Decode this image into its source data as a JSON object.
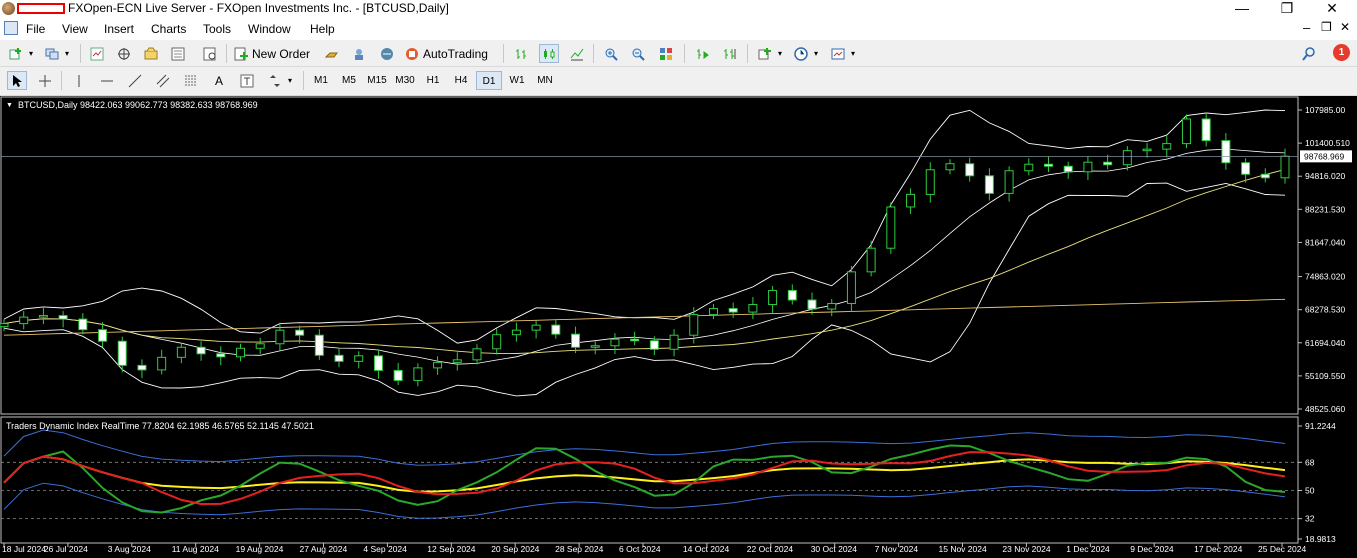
{
  "window": {
    "title": "FXOpen-ECN Live Server - FXOpen Investments Inc. - [BTCUSD,Daily]",
    "controls": [
      "—",
      "❐",
      "✕"
    ]
  },
  "menu": [
    "File",
    "View",
    "Insert",
    "Charts",
    "Tools",
    "Window",
    "Help"
  ],
  "toolbar": {
    "new_order": "New Order",
    "autotrading": "AutoTrading",
    "notifications": "1"
  },
  "timeframes": [
    "M1",
    "M5",
    "M15",
    "M30",
    "H1",
    "H4",
    "D1",
    "W1",
    "MN"
  ],
  "active_timeframe": "D1",
  "chart": {
    "label": "BTCUSD,Daily  98422.063 99062.773 98382.633 98768.969",
    "current_price": "98768.969",
    "price_ticks": [
      "107985.00",
      "101400.510",
      "94816.020",
      "88231.530",
      "81647.040",
      "74863.020",
      "68278.530",
      "61694.040",
      "55109.550",
      "48525.060"
    ],
    "dates": [
      "18 Jul 2024",
      "26 Jul 2024",
      "3 Aug 2024",
      "11 Aug 2024",
      "19 Aug 2024",
      "27 Aug 2024",
      "4 Sep 2024",
      "12 Sep 2024",
      "20 Sep 2024",
      "28 Sep 2024",
      "6 Oct 2024",
      "14 Oct 2024",
      "22 Oct 2024",
      "30 Oct 2024",
      "7 Nov 2024",
      "15 Nov 2024",
      "23 Nov 2024",
      "1 Dec 2024",
      "9 Dec 2024",
      "17 Dec 2024",
      "25 Dec 2024"
    ]
  },
  "indicator": {
    "label": "Traders Dynamic Index RealTime 77.8204 62.1985 46.5765 52.1145 47.5021",
    "ticks": [
      "91.2244",
      "68",
      "50",
      "32",
      "18.9813"
    ]
  },
  "chart_data": {
    "type": "line",
    "symbol": "BTCUSD",
    "timeframe": "Daily",
    "series_close_approx": [
      65500,
      66800,
      67100,
      66400,
      64300,
      62000,
      57200,
      56300,
      58800,
      60800,
      59500,
      58900,
      60600,
      61500,
      64200,
      63200,
      59200,
      58000,
      59100,
      56200,
      54200,
      56700,
      57800,
      58300,
      60500,
      63300,
      64200,
      65200,
      63400,
      60800,
      61100,
      62400,
      62100,
      60400,
      63200,
      67300,
      68500,
      67800,
      69300,
      72100,
      70200,
      68400,
      69500,
      75800,
      80500,
      88700,
      91200,
      96100,
      97300,
      94900,
      91400,
      95900,
      97200,
      96800,
      95700,
      97600,
      97100,
      99900,
      100200,
      101300,
      106200,
      101900,
      97500,
      95200,
      94500,
      98800
    ],
    "price_range": [
      48525.06,
      107985.0
    ],
    "indicator_range": [
      18.9813,
      91.2244
    ],
    "indicator_levels": [
      68,
      50,
      32
    ]
  }
}
